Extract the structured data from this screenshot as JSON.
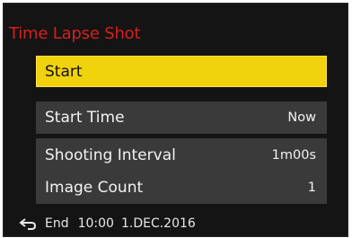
{
  "menu": {
    "title": "Time Lapse Shot",
    "start_label": "Start",
    "items": [
      {
        "label": "Start Time",
        "value": "Now"
      },
      {
        "label": "Shooting Interval",
        "value": "1m00s"
      },
      {
        "label": "Image Count",
        "value": "1"
      }
    ]
  },
  "status": {
    "back_icon": "return-arrow-icon",
    "end_label": "End",
    "time": "10:00",
    "date": "1.DEC.2016"
  },
  "colors": {
    "title": "#d81f1f",
    "selected_bg": "#f0d20d",
    "panel_bg": "#3a3a3a",
    "screen_bg": "#141414"
  }
}
